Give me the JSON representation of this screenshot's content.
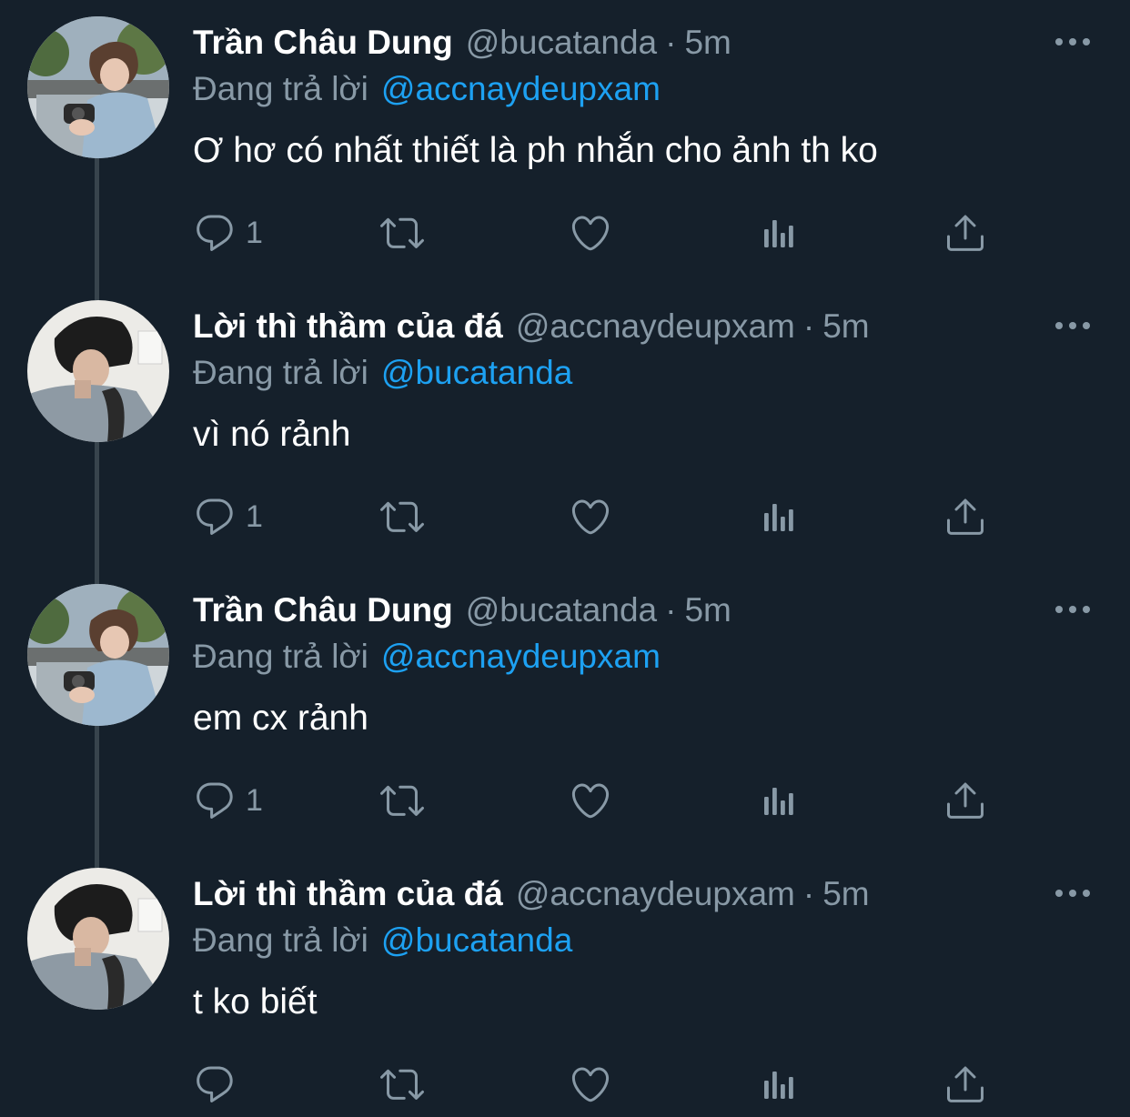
{
  "thread": {
    "tweets": [
      {
        "name": "Trần Châu Dung",
        "handle": "@bucatanda",
        "separator": "·",
        "time": "5m",
        "reply_label": "Đang trả lời",
        "reply_to": "@accnaydeupxam",
        "text": "Ơ hơ có nhất thiết là ph nhắn cho ảnh th ko",
        "reply_count": "1",
        "avatar": "person-holding-camera-avatar"
      },
      {
        "name": "Lời thì thầm của đá",
        "handle": "@accnaydeupxam",
        "separator": "·",
        "time": "5m",
        "reply_label": "Đang trả lời",
        "reply_to": "@bucatanda",
        "text": "vì nó rảnh",
        "reply_count": "1",
        "avatar": "person-with-backpack-avatar"
      },
      {
        "name": "Trần Châu Dung",
        "handle": "@bucatanda",
        "separator": "·",
        "time": "5m",
        "reply_label": "Đang trả lời",
        "reply_to": "@accnaydeupxam",
        "text": "em cx rảnh",
        "reply_count": "1",
        "avatar": "person-holding-camera-avatar"
      },
      {
        "name": "Lời thì thầm của đá",
        "handle": "@accnaydeupxam",
        "separator": "·",
        "time": "5m",
        "reply_label": "Đang trả lời",
        "reply_to": "@bucatanda",
        "text": "t ko biết",
        "reply_count": "",
        "avatar": "person-with-backpack-avatar"
      }
    ]
  },
  "icons": {
    "reply": "reply-icon",
    "retweet": "retweet-icon",
    "like": "heart-icon",
    "stats": "analytics-icon",
    "share": "share-icon",
    "more": "more-icon"
  },
  "colors": {
    "background": "#15202b",
    "primary_text": "#ffffff",
    "secondary_text": "#8899a6",
    "accent": "#1da1f2",
    "thread_line": "#38444d"
  }
}
